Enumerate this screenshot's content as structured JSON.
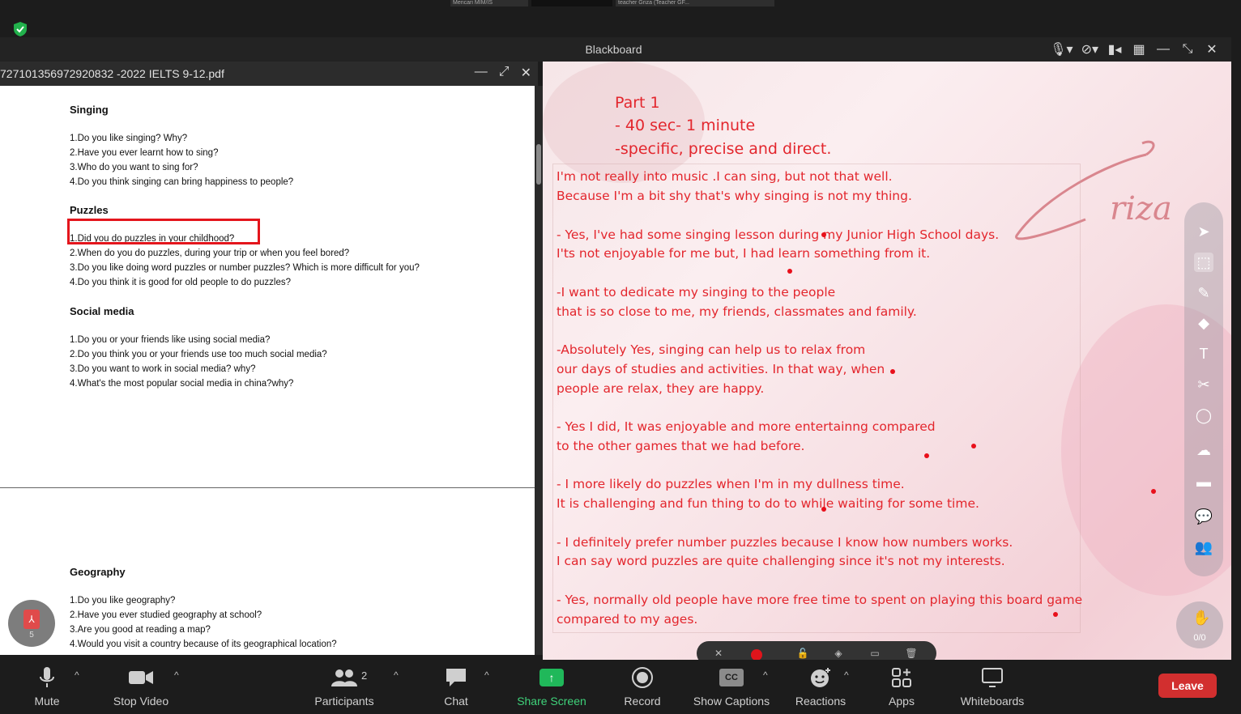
{
  "window": {
    "title": "Blackboard",
    "thumbnails": [
      "Mencari MIM/IS",
      "",
      "teacher Griza (Teacher GF..."
    ]
  },
  "pdf": {
    "filename": "727101356972920832 -2022 IELTS 9-12.pdf",
    "page_number": "5",
    "sections": [
      {
        "heading": "Singing",
        "questions": [
          "1.Do you like singing? Why?",
          "2.Have you ever learnt how to sing?",
          "3.Who do you want to sing for?",
          "4.Do you think singing can bring happiness to people?"
        ]
      },
      {
        "heading": "Puzzles",
        "questions": [
          "1.Did you do puzzles in your childhood?",
          "2.When do you do puzzles, during your trip or when you feel bored?",
          "3.Do you like doing word puzzles or number puzzles? Which is more difficult for you?",
          "4.Do you think it is good for old people to do puzzles?"
        ]
      },
      {
        "heading": "Social media",
        "questions": [
          "1.Do you or your friends like using social media?",
          "2.Do you think you or your friends use too much social media?",
          "3.Do you want to work in social media? why?",
          "4.What's the most popular social media in china?why?"
        ]
      },
      {
        "heading": "Geography",
        "questions": [
          "1.Do you like geography?",
          "2.Have you ever studied geography at school?",
          "3.Are you good at reading a map?",
          "4.Would you visit a country because of its geographical location?"
        ]
      }
    ]
  },
  "whiteboard": {
    "heading_lines": [
      "Part 1",
      "- 40 sec- 1 minute",
      "-specific, precise and direct."
    ],
    "signature": "Criza",
    "answers": [
      [
        "I'm not really into music .I can sing, but not that well.",
        "Because I'm a bit shy that's why singing is not my thing."
      ],
      [
        "- Yes, I've had some singing lesson during my Junior High School days.",
        "I'ts not enjoyable for me but, I had learn something from it."
      ],
      [
        "-I want to dedicate my singing to the people",
        "that is so close to me, my friends, classmates and family."
      ],
      [
        "-Absolutely Yes, singing can help us to relax from",
        "our days of studies and activities. In that way, when",
        "people are relax, they are happy."
      ],
      [
        "- Yes I did, It was enjoyable and more entertainng compared",
        "to the other games that we had before."
      ],
      [
        "- I more likely do puzzles when I'm in my dullness time.",
        "It is challenging and fun thing to do to while waiting for some time."
      ],
      [
        "- I definitely prefer number puzzles because I know how numbers works.",
        "I can say word puzzles are quite challenging since it's not my interests."
      ],
      [
        "- Yes, normally old people have more free time to spent on playing this board game",
        "compared to my ages."
      ]
    ],
    "page_counter": "0/0",
    "ink_color": "#e3262d"
  },
  "toolbar": {
    "mute": "Mute",
    "stop_video": "Stop Video",
    "participants": "Participants",
    "participants_count": "2",
    "chat": "Chat",
    "share_screen": "Share Screen",
    "record": "Record",
    "show_captions": "Show Captions",
    "captions_icon": "CC",
    "reactions": "Reactions",
    "apps": "Apps",
    "whiteboards": "Whiteboards",
    "leave": "Leave",
    "share_color": "#20b85a",
    "leave_color": "#d22f2f"
  }
}
